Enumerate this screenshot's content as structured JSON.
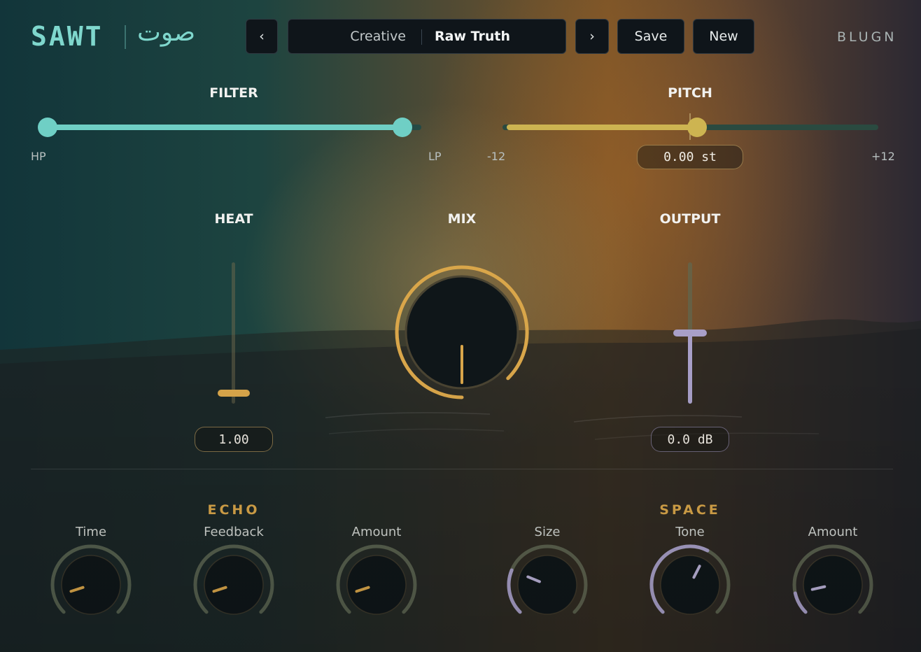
{
  "header": {
    "brand": "SAWT",
    "brand_arabic": "صوت",
    "vendor": "BLUGN",
    "prev_label": "‹",
    "next_label": "›",
    "preset_category": "Creative",
    "preset_name": "Raw Truth",
    "save_label": "Save",
    "new_label": "New"
  },
  "filter": {
    "title": "FILTER",
    "low_label": "HP",
    "high_label": "LP",
    "hp_position": 0.0,
    "lp_position": 0.95
  },
  "pitch": {
    "title": "PITCH",
    "min_label": "-12",
    "max_label": "+12",
    "value_text": "0.00 st",
    "value": 0.0
  },
  "heat": {
    "title": "HEAT",
    "value_text": "1.00",
    "level": 0.05
  },
  "mix": {
    "title": "MIX",
    "level": 1.0
  },
  "output": {
    "title": "OUTPUT",
    "value_text": "0.0 dB",
    "level": 0.5
  },
  "echo": {
    "title": "ECHO",
    "knobs": [
      {
        "label": "Time",
        "level": 0.1
      },
      {
        "label": "Feedback",
        "level": 0.1
      },
      {
        "label": "Amount",
        "level": 0.1
      }
    ]
  },
  "space": {
    "title": "SPACE",
    "knobs": [
      {
        "label": "Size",
        "level": 0.25
      },
      {
        "label": "Tone",
        "level": 0.6
      },
      {
        "label": "Amount",
        "level": 0.12
      }
    ]
  },
  "colors": {
    "teal": "#6fcfc5",
    "gold": "#d9a64a",
    "pitch_yellow": "#cdb451",
    "lavender": "#a89fc8",
    "knob_face": "#0f1619"
  }
}
